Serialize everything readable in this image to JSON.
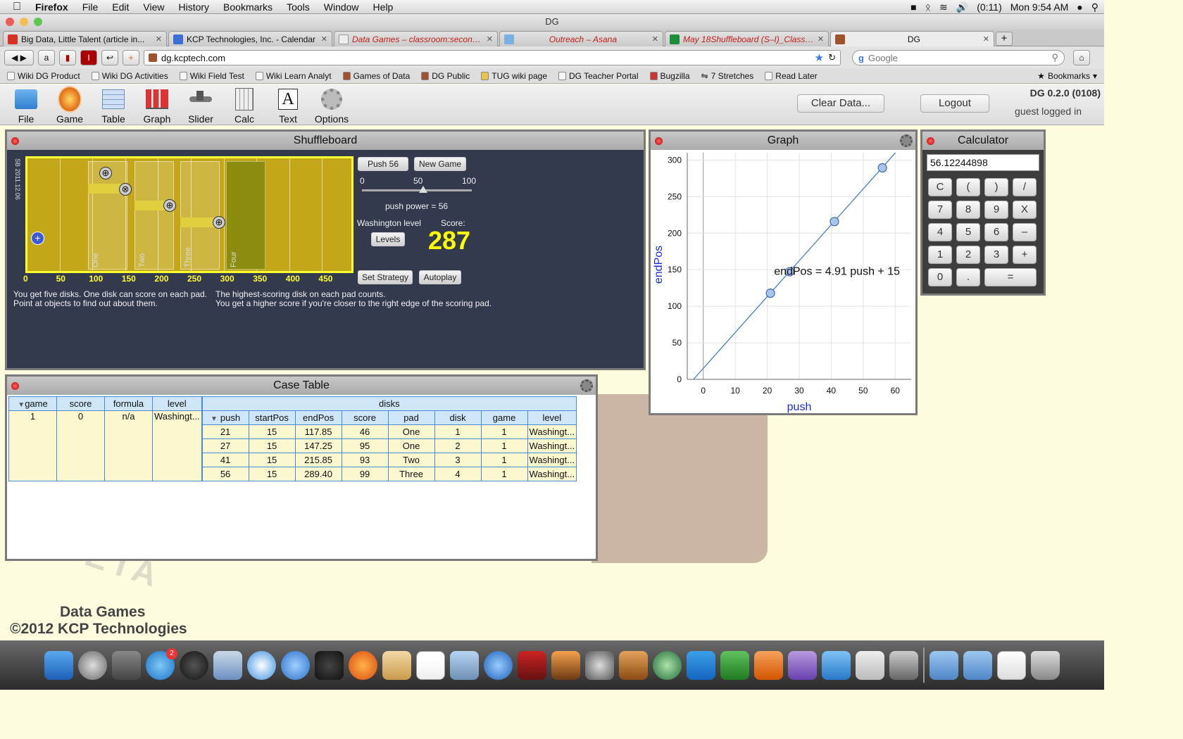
{
  "menubar": {
    "app": "Firefox",
    "items": [
      "File",
      "Edit",
      "View",
      "History",
      "Bookmarks",
      "Tools",
      "Window",
      "Help"
    ],
    "battery": "(0:11)",
    "clock": "Mon 9:54 AM"
  },
  "window": {
    "title": "DG"
  },
  "tabs": [
    {
      "title": "Big Data, Little Talent (article in...",
      "icon_color": "#d93025"
    },
    {
      "title": "KCP Technologies, Inc. - Calendar",
      "icon_color": "#3b6fd1"
    },
    {
      "title": "Data Games – classroom:seconda...",
      "icon_color": "#dddddd"
    },
    {
      "title": "Outreach – Asana",
      "icon_color": "#7ab0e0"
    },
    {
      "title": "May 18Shuffleboard (S–I)_Classro...",
      "icon_color": "#1e8e3e"
    },
    {
      "title": "DG",
      "icon_color": "#a0522d"
    }
  ],
  "nav": {
    "url": "dg.kcptech.com",
    "search_placeholder": "Google"
  },
  "bookmarks": [
    "Wiki DG Product",
    "Wiki DG Activities",
    "Wiki Field Test",
    "Wiki Learn Analyt",
    "Games of Data",
    "DG Public",
    "TUG wiki page",
    "DG Teacher Portal",
    "Bugzilla",
    "7 Stretches",
    "Read Later"
  ],
  "bookmarks_menu": "Bookmarks",
  "toolbar": {
    "tools": [
      "File",
      "Game",
      "Table",
      "Graph",
      "Slider",
      "Calc",
      "Text",
      "Options"
    ],
    "clear_label": "Clear Data...",
    "logout_label": "Logout",
    "version": "DG 0.2.0 (0108)",
    "user_status": "guest logged in"
  },
  "shuffleboard": {
    "title": "Shuffleboard",
    "side_label": "SB 2011.12.06",
    "pads": [
      "One",
      "Two",
      "Three",
      "Four"
    ],
    "ticks": [
      "0",
      "50",
      "100",
      "150",
      "200",
      "250",
      "300",
      "350",
      "400",
      "450"
    ],
    "push_label": "Push 56",
    "new_game_label": "New Game",
    "slider_min": "0",
    "slider_mid": "50",
    "slider_max": "100",
    "slider_value": 56,
    "power_text": "push power = 56",
    "level_text": "Washington level",
    "levels_label": "Levels",
    "score_label": "Score:",
    "score": "287",
    "strategy_label": "Set Strategy",
    "autoplay_label": "Autoplay",
    "help_left": [
      "You get five disks. One disk can score on each pad.",
      "Point at objects to find out about them."
    ],
    "help_right": [
      "The highest-scoring disk on each pad counts.",
      "You get a higher score if you're closer to the right edge of the scoring pad."
    ]
  },
  "graph": {
    "title": "Graph",
    "equation": "endPos = 4.91 push + 15"
  },
  "chart_data": {
    "type": "scatter",
    "x": [
      21,
      27,
      41,
      56
    ],
    "y": [
      117.85,
      147.25,
      215.85,
      289.4
    ],
    "xlabel": "push",
    "ylabel": "endPos",
    "xlim": [
      -5,
      65
    ],
    "ylim": [
      0,
      310
    ],
    "xticks": [
      "0",
      "10",
      "20",
      "30",
      "40",
      "50",
      "60"
    ],
    "yticks": [
      "0",
      "50",
      "100",
      "150",
      "200",
      "250",
      "300"
    ],
    "fit": {
      "slope": 4.91,
      "intercept": 15
    },
    "grid": true
  },
  "calculator": {
    "title": "Calculator",
    "display": "56.12244898",
    "keys": [
      "C",
      "(",
      ")",
      "/",
      "7",
      "8",
      "9",
      "X",
      "4",
      "5",
      "6",
      "–",
      "1",
      "2",
      "3",
      "+",
      "0",
      ".",
      "="
    ]
  },
  "case_table": {
    "title": "Case Table",
    "parent_headers": [
      "game",
      "score",
      "formula",
      "level"
    ],
    "parent_row": [
      "1",
      "0",
      "n/a",
      "Washingt..."
    ],
    "group_header": "disks",
    "child_headers": [
      "push",
      "startPos",
      "endPos",
      "score",
      "pad",
      "disk",
      "game",
      "level"
    ],
    "child_rows": [
      [
        "21",
        "15",
        "117.85",
        "46",
        "One",
        "1",
        "1",
        "Washingt..."
      ],
      [
        "27",
        "15",
        "147.25",
        "95",
        "One",
        "2",
        "1",
        "Washingt..."
      ],
      [
        "41",
        "15",
        "215.85",
        "93",
        "Two",
        "3",
        "1",
        "Washingt..."
      ],
      [
        "56",
        "15",
        "289.40",
        "99",
        "Three",
        "4",
        "1",
        "Washingt..."
      ]
    ]
  },
  "footer": {
    "line1": "Data Games",
    "line2": "©2012 KCP Technologies",
    "watermark": "BETA"
  },
  "dock": {
    "badge": "2"
  }
}
